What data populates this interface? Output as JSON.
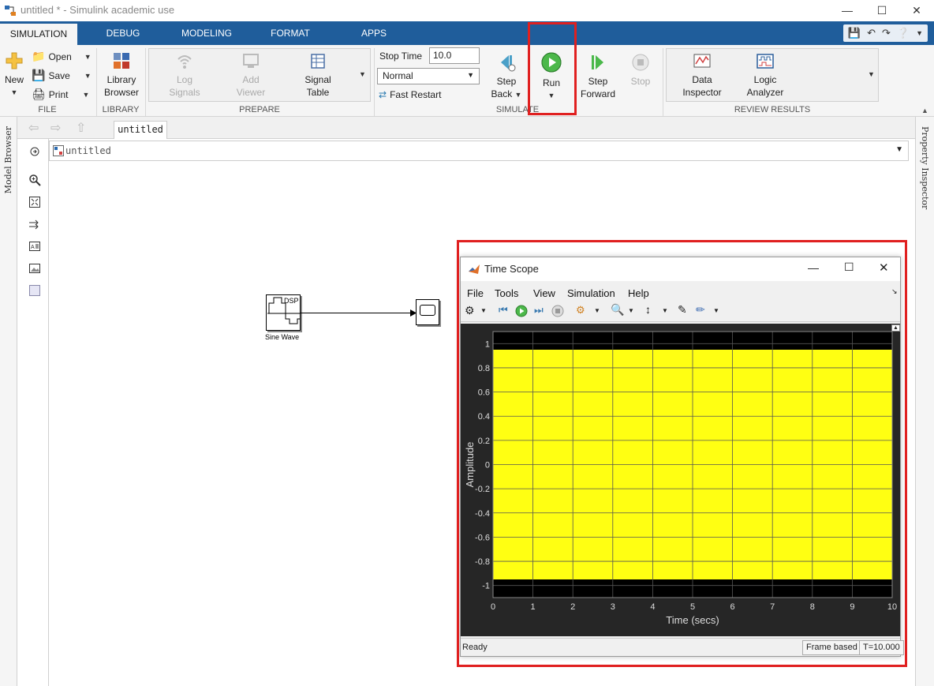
{
  "window": {
    "title": "untitled * - Simulink academic use"
  },
  "ribbon_tabs": [
    "SIMULATION",
    "DEBUG",
    "MODELING",
    "FORMAT",
    "APPS"
  ],
  "file_group": {
    "new": "New",
    "open": "Open",
    "save": "Save",
    "print": "Print",
    "label": "FILE"
  },
  "library_group": {
    "library_browser_1": "Library",
    "library_browser_2": "Browser",
    "label": "LIBRARY"
  },
  "prepare_group": {
    "log_signals_1": "Log",
    "log_signals_2": "Signals",
    "add_viewer_1": "Add",
    "add_viewer_2": "Viewer",
    "signal_table_1": "Signal",
    "signal_table_2": "Table",
    "label": "PREPARE"
  },
  "simulate_group": {
    "stop_time_label": "Stop Time",
    "stop_time_value": "10.0",
    "mode": "Normal",
    "fast_restart": "Fast Restart",
    "step_back_1": "Step",
    "step_back_2": "Back",
    "run": "Run",
    "step_forward_1": "Step",
    "step_forward_2": "Forward",
    "stop": "Stop",
    "label": "SIMULATE"
  },
  "review_group": {
    "data_inspector_1": "Data",
    "data_inspector_2": "Inspector",
    "logic_analyzer_1": "Logic",
    "logic_analyzer_2": "Analyzer",
    "label": "REVIEW RESULTS"
  },
  "side_panels": {
    "left": "Model Browser",
    "right": "Property Inspector"
  },
  "canvas": {
    "tab": "untitled",
    "address": "untitled"
  },
  "blocks": {
    "sine_label": "DSP",
    "sine_name": "Sine Wave"
  },
  "scope": {
    "title": "Time Scope",
    "menu": [
      "File",
      "Tools",
      "View",
      "Simulation",
      "Help"
    ],
    "status": "Ready",
    "frame_mode": "Frame based",
    "time": "T=10.000"
  },
  "colors": {
    "accent": "#1f5d9b",
    "highlight": "#e02020",
    "signal": "#ffff12",
    "plot_bg": "#000000"
  },
  "chart_data": {
    "type": "area",
    "x": [
      0,
      10
    ],
    "upper": [
      0.95,
      0.95
    ],
    "lower": [
      -0.95,
      -0.95
    ],
    "xlabel": "Time (secs)",
    "ylabel": "Amplitude",
    "xlim": [
      0,
      10
    ],
    "ylim": [
      -1.1,
      1.1
    ],
    "xticks": [
      0,
      1,
      2,
      3,
      4,
      5,
      6,
      7,
      8,
      9,
      10
    ],
    "yticks": [
      1,
      0.8,
      0.6,
      0.4,
      0.2,
      0,
      -0.2,
      -0.4,
      -0.6,
      -0.8,
      -1
    ],
    "ytick_labels": [
      "1",
      "0.8",
      "0.6",
      "0.4",
      "0.2",
      "0",
      "-0.2",
      "-0.4",
      "-0.6",
      "-0.8",
      "-1"
    ],
    "grid": true
  }
}
